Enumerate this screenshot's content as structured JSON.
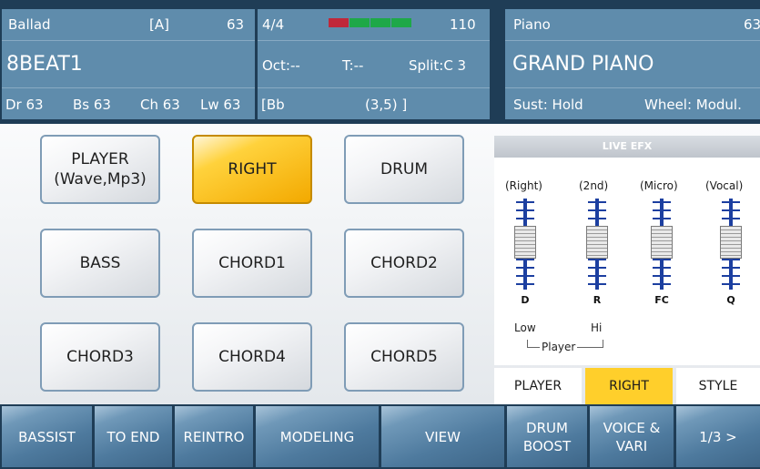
{
  "style_panel": {
    "name": "Ballad",
    "variation": "[A]",
    "volume": "63",
    "style_title": "8BEAT1",
    "levels": [
      "Dr 63",
      "Bs 63",
      "Ch 63",
      "Lw 63"
    ]
  },
  "tempo_panel": {
    "time_signature": "4/4",
    "bpm": "110",
    "octave": "Oct:--",
    "transpose": "T:--",
    "split": "Split:C 3",
    "chord": "[Bb",
    "measure": "(3,5) ]",
    "beat_leds": [
      "#c0283a",
      "#1ea848",
      "#1ea848",
      "#1ea848"
    ]
  },
  "voice_panel": {
    "category": "Piano",
    "volume": "63",
    "voice_title": "GRAND PIANO",
    "sustain": "Sust: Hold",
    "wheel": "Wheel: Modul."
  },
  "parts": [
    {
      "label": "PLAYER\n(Wave,Mp3)",
      "active": false
    },
    {
      "label": "RIGHT",
      "active": true
    },
    {
      "label": "DRUM",
      "active": false
    },
    {
      "label": "BASS",
      "active": false
    },
    {
      "label": "CHORD1",
      "active": false
    },
    {
      "label": "CHORD2",
      "active": false
    },
    {
      "label": "CHORD3",
      "active": false
    },
    {
      "label": "CHORD4",
      "active": false
    },
    {
      "label": "CHORD5",
      "active": false
    }
  ],
  "live_efx": {
    "title": "LIVE EFX",
    "slots": [
      {
        "label": "(Right)",
        "letter": "D"
      },
      {
        "label": "(2nd)",
        "letter": "R"
      },
      {
        "label": "(Micro)",
        "letter": "FC"
      },
      {
        "label": "(Vocal)",
        "letter": "Q"
      }
    ],
    "low_label": "Low",
    "hi_label": "Hi",
    "player_label": "Player",
    "tabs": [
      "PLAYER",
      "RIGHT",
      "STYLE"
    ],
    "active_tab": "RIGHT"
  },
  "function_bar": [
    "BASSIST",
    "TO END",
    "REINTRO",
    "MODELING",
    "VIEW",
    "DRUM\nBOOST",
    "VOICE &\nVARI",
    "1/3 >"
  ],
  "colors": {
    "accent_yellow": "#ffcf2b",
    "panel_blue": "#5f8cac",
    "frame_navy": "#1f3d56"
  }
}
